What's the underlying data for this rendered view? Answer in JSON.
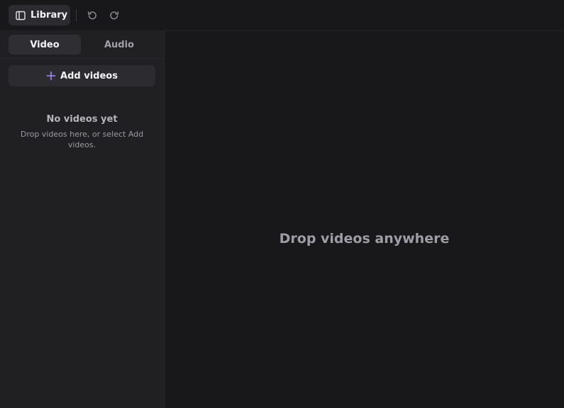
{
  "toolbar": {
    "library_label": "Library",
    "library_icon": "sidebar-panel-icon",
    "undo_icon": "undo-icon",
    "redo_icon": "redo-icon"
  },
  "sidebar": {
    "tabs": [
      {
        "label": "Video",
        "active": true
      },
      {
        "label": "Audio",
        "active": false
      }
    ],
    "add_button_label": "Add videos",
    "add_icon": "plus-icon",
    "accent_color": "#a78bfa",
    "empty_state": {
      "title": "No videos yet",
      "description": "Drop videos here, or select Add videos."
    }
  },
  "main": {
    "drop_hint": "Drop videos anywhere"
  }
}
